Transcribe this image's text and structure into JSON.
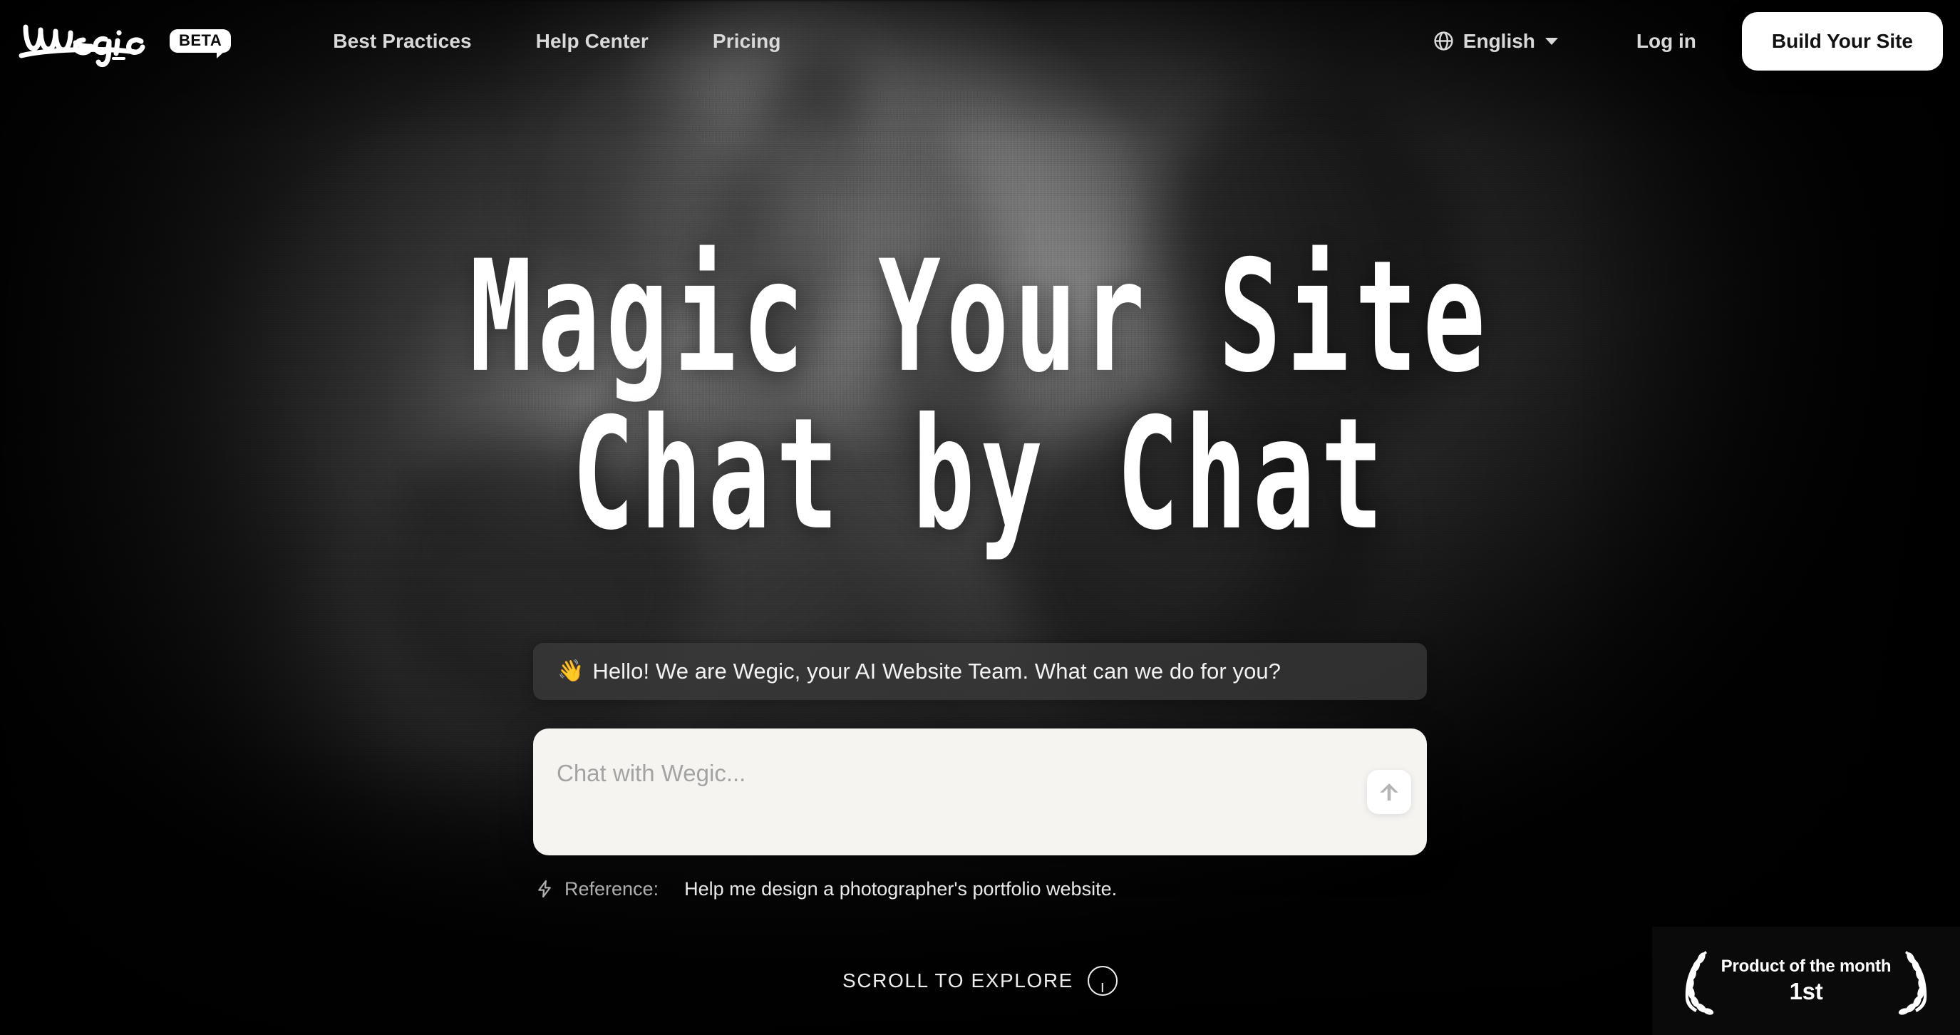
{
  "brand": {
    "name": "Wegic",
    "badge_label": "BETA"
  },
  "nav": {
    "links": [
      {
        "label": "Best Practices",
        "icon": ""
      },
      {
        "label": "Help Center",
        "icon": ""
      },
      {
        "label": "Pricing",
        "icon": ""
      }
    ],
    "language": {
      "icon": "globe-icon",
      "label": "English",
      "caret": "chevron-down-icon"
    },
    "login_label": "Log in",
    "cta_label": "Build Your Site"
  },
  "hero": {
    "headline_line1": "Magic Your Site",
    "headline_line2": "Chat by Chat"
  },
  "greeting": {
    "emoji": "👋",
    "text": "Hello! We are Wegic, your AI Website Team. What can we do for you?"
  },
  "composer": {
    "placeholder": "Chat with Wegic...",
    "value": "",
    "send_icon": "arrow-up-icon"
  },
  "reference": {
    "icon": "zap-icon",
    "label": "Reference:",
    "suggestion": "Help me design a photographer's portfolio website."
  },
  "scroll": {
    "label": "SCROLL TO EXPLORE",
    "icon": "scroll-circle-icon"
  },
  "award_badge": {
    "icon": "laurel-wreath-icon",
    "title": "Product of the month",
    "rank": "1st"
  },
  "colors": {
    "background": "#0b0b0b",
    "nav_text": "#d9d9d9",
    "cta_bg": "#ffffff",
    "cta_text": "#111111",
    "headline": "#ffffff",
    "greeting_bg": "rgba(60,60,60,0.72)",
    "composer_bg": "#f5f4f1",
    "placeholder": "#a3a3a3",
    "send_arrow": "#b4b4b4",
    "reference_label": "#b0b0b0",
    "badge_bg": "#0a0a0a"
  }
}
